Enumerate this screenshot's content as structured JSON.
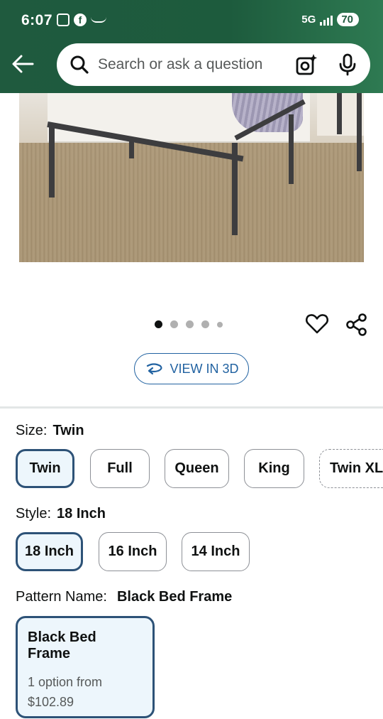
{
  "status": {
    "time": "6:07",
    "network": "5G",
    "battery": "70"
  },
  "search": {
    "placeholder": "Search or ask a question"
  },
  "gallery": {
    "pages": 5,
    "active_index": 0,
    "view_3d_label": "VIEW IN 3D"
  },
  "size": {
    "label": "Size:",
    "selected": "Twin",
    "options": [
      "Twin",
      "Full",
      "Queen",
      "King",
      "Twin XL"
    ]
  },
  "style": {
    "label": "Style:",
    "selected": "18 Inch",
    "options": [
      "18 Inch",
      "16 Inch",
      "14 Inch"
    ]
  },
  "pattern": {
    "label": "Pattern Name:",
    "selected": "Black Bed Frame",
    "card": {
      "title": "Black Bed Frame",
      "options_text": "1 option from",
      "price": "$102.89"
    }
  },
  "colors": {
    "header_green": "#1f5a3e",
    "link_blue": "#2162a1",
    "selected_border": "#2d5277",
    "selected_fill": "#edf6fc"
  },
  "icons": [
    "back-arrow-icon",
    "search-icon",
    "camera-lens-icon",
    "microphone-icon",
    "heart-icon",
    "share-icon",
    "rotate-3d-icon"
  ]
}
